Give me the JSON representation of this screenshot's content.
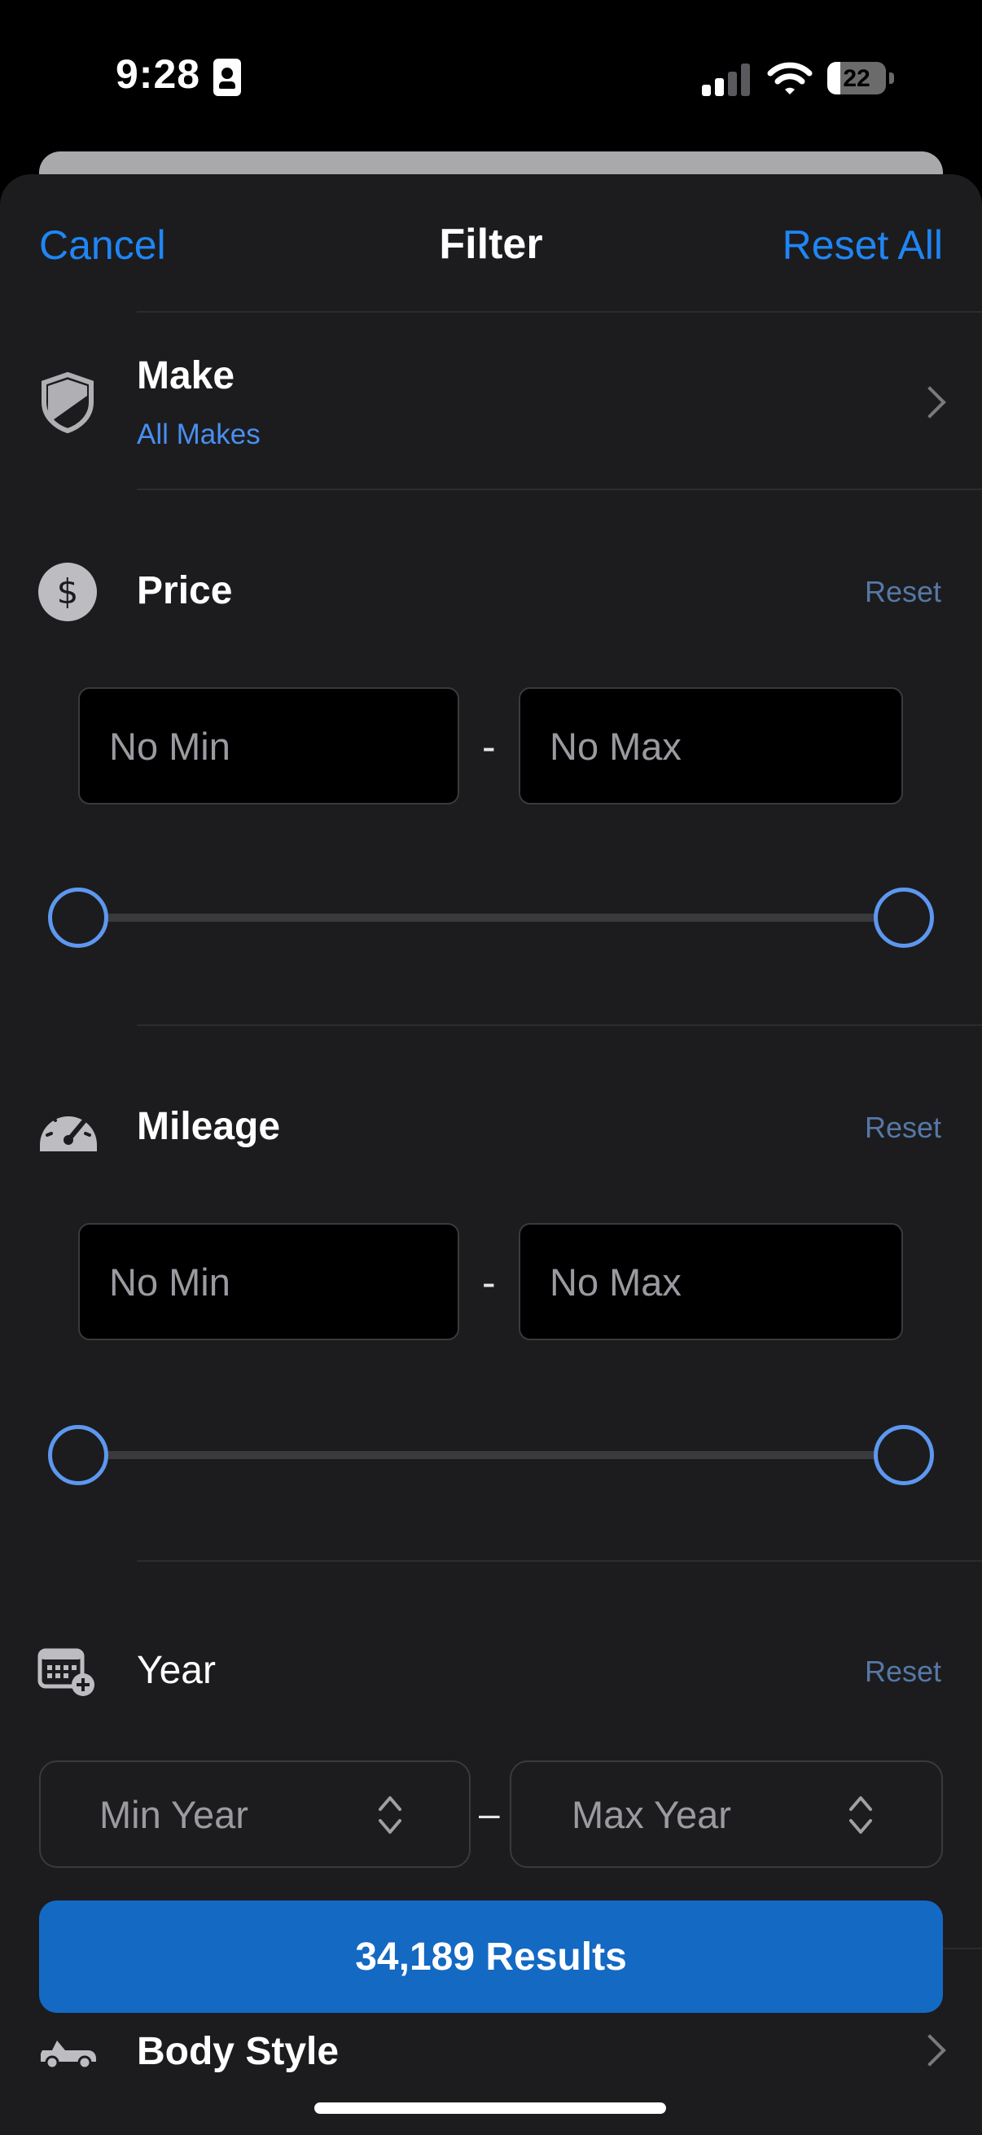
{
  "status_bar": {
    "time": "9:28",
    "battery": "22",
    "battery_level": 0.22
  },
  "header": {
    "cancel": "Cancel",
    "title": "Filter",
    "reset_all": "Reset All"
  },
  "make": {
    "title": "Make",
    "value": "All Makes"
  },
  "price": {
    "title": "Price",
    "reset": "Reset",
    "min_placeholder": "No Min",
    "max_placeholder": "No Max",
    "separator": "-",
    "range_min": 0,
    "range_max": 1
  },
  "mileage": {
    "title": "Mileage",
    "reset": "Reset",
    "min_placeholder": "No Min",
    "max_placeholder": "No Max",
    "separator": "-",
    "range_min": 0,
    "range_max": 1
  },
  "year": {
    "title": "Year",
    "reset": "Reset",
    "min_label": "Min Year",
    "max_label": "Max Year",
    "separator": "–"
  },
  "results_button": "34,189 Results",
  "body_style": {
    "title": "Body Style"
  },
  "colors": {
    "accent": "#1f86f4",
    "results_button": "#1469c3",
    "sheet_bg": "#1c1c1e",
    "slider": "#5d97ef"
  }
}
